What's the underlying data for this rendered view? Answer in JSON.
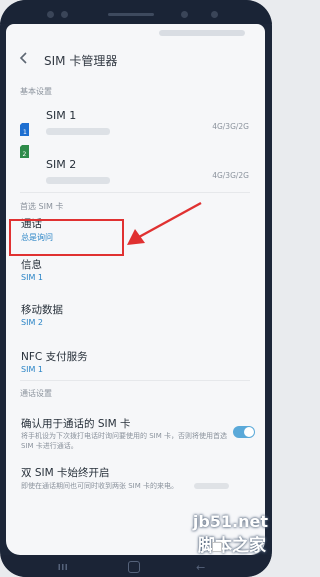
{
  "header": {
    "title": "SIM 卡管理器"
  },
  "sections": {
    "basic": "基本设置",
    "preferred": "首选 SIM 卡",
    "call": "通话设置"
  },
  "sims": [
    {
      "name": "SIM 1",
      "badge": "1",
      "network": "4G/3G/2G",
      "color": "#1e6fd1"
    },
    {
      "name": "SIM 2",
      "badge": "2",
      "network": "4G/3G/2G",
      "color": "#2e8b4a"
    }
  ],
  "preferred": [
    {
      "title": "通话",
      "value": "总是询问"
    },
    {
      "title": "信息",
      "value": "SIM 1"
    },
    {
      "title": "移动数据",
      "value": "SIM 2"
    },
    {
      "title": "NFC 支付服务",
      "value": "SIM 1"
    }
  ],
  "call_settings": {
    "confirm_title": "确认用于通话的 SIM 卡",
    "confirm_desc": "将手机设为下次拨打电话时询问要使用的 SIM 卡，否则将使用首选 SIM 卡进行通话。",
    "confirm_on": true,
    "dual_title": "双 SIM 卡始终开启",
    "dual_desc": "即使在通话期间也可同时收到两张 SIM 卡的来电。"
  },
  "watermark": {
    "site": "jb51.net",
    "name": "脚本之家"
  },
  "colors": {
    "accent": "#2a84c6",
    "highlight": "#e03131"
  }
}
